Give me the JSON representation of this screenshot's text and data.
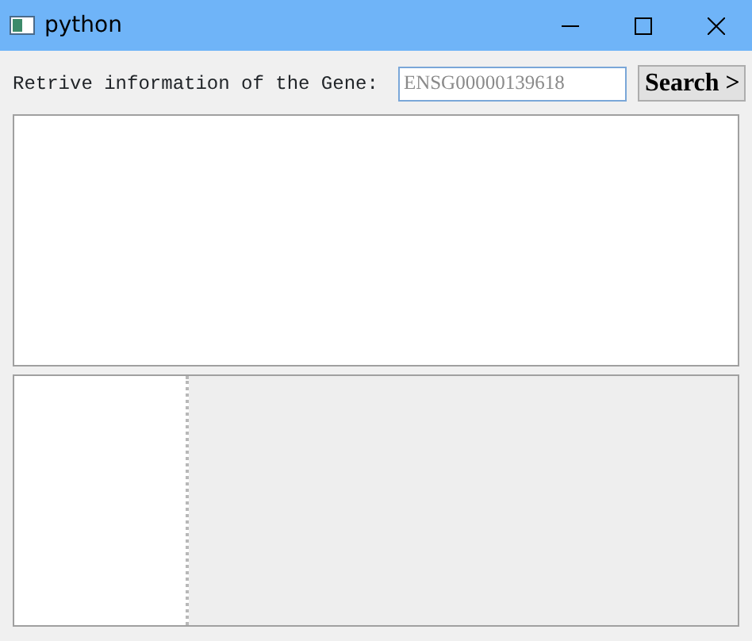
{
  "window": {
    "title": "python"
  },
  "query": {
    "label": "Retrive information of the Gene:",
    "placeholder": "ENSG00000139618",
    "button": "Search >"
  }
}
